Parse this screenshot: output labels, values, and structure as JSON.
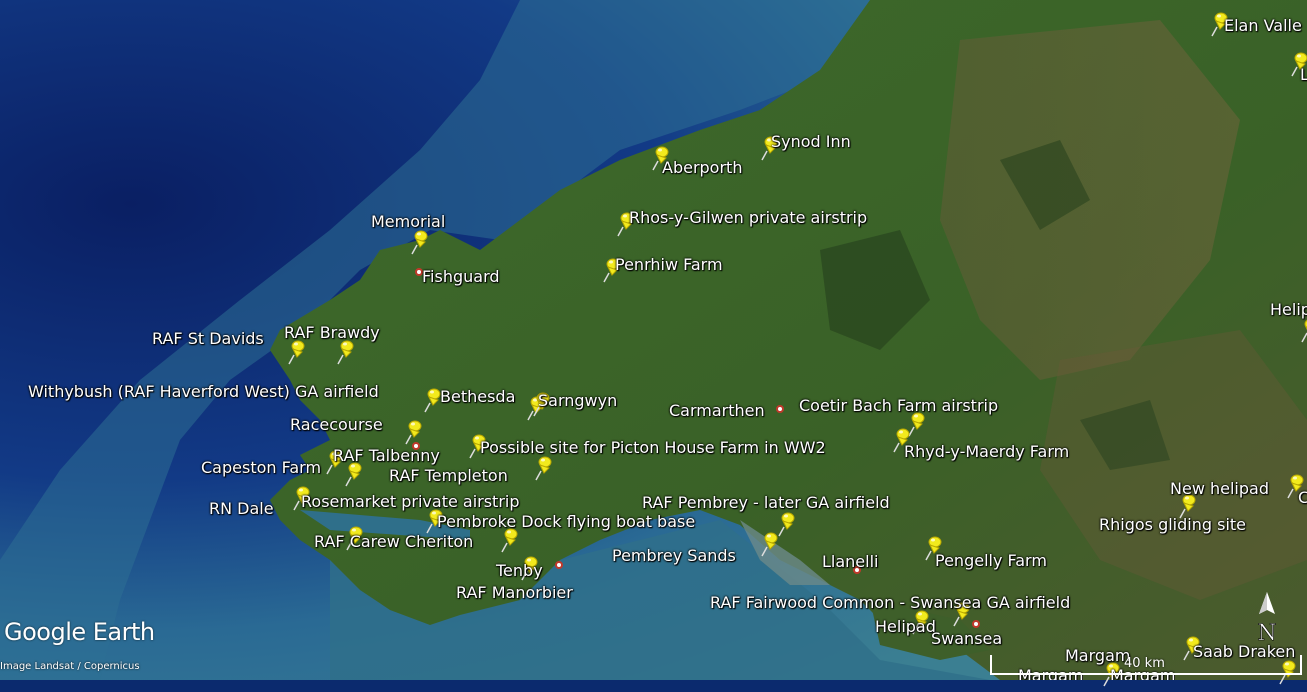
{
  "brand": "Google Earth",
  "credit": "Image Landsat / Copernicus",
  "scale": "40 km",
  "compass": "N",
  "colors": {
    "pin": "#f2ea1d",
    "pin_dark": "#b8a800",
    "sea_deep": "#0b2a6e",
    "sea_shallow": "#2f7f95",
    "land": "#3f6b2c"
  },
  "labels": {
    "aberporth": "Aberporth",
    "synod_inn": "Synod Inn",
    "elan_valley": "Elan Valle",
    "memorial": "Memorial",
    "fishguard": "Fishguard",
    "rhos": "Rhos-y-Gilwen private airstrip",
    "penrhiw": "Penrhiw Farm",
    "raf_st_davids": "RAF St Davids",
    "raf_brawdy": "RAF Brawdy",
    "withybush": "Withybush (RAF Haverford West) GA airfield",
    "bethesda": "Bethesda",
    "sarngwyn": "Sarngwyn",
    "carmarthen": "Carmarthen",
    "coetir": "Coetir Bach Farm airstrip",
    "racecourse": "Racecourse",
    "picton": "Possible site for Picton House Farm in WW2",
    "raf_talbenny": "RAF Talbenny",
    "rhyd": "Rhyd-y-Maerdy Farm",
    "capeston": "Capeston Farm",
    "raf_templeton": "RAF Templeton",
    "new_helipad": "New helipad",
    "rn_dale": "RN Dale",
    "rosemarket": "Rosemarket private airstrip",
    "raf_pembrey": "RAF Pembrey - later GA airfield",
    "rhigos": "Rhigos gliding site",
    "pembroke_dock": "Pembroke Dock flying boat base",
    "raf_carew": "RAF Carew Cheriton",
    "pembrey_sands": "Pembrey Sands",
    "llanelli": "Llanelli",
    "pengelly": "Pengelly Farm",
    "tenby": "Tenby",
    "raf_manorbier": "RAF Manorbier",
    "raf_fairwood": "RAF Fairwood Common - Swansea GA airfield",
    "helipad": "Helipad",
    "swansea": "Swansea",
    "margam": "Margam",
    "saab": "Saab Draken",
    "heli_edge": "Helip",
    "l_edge": "L",
    "c_edge": "C",
    "margam2": "Margam",
    "margam3": "Margam"
  }
}
